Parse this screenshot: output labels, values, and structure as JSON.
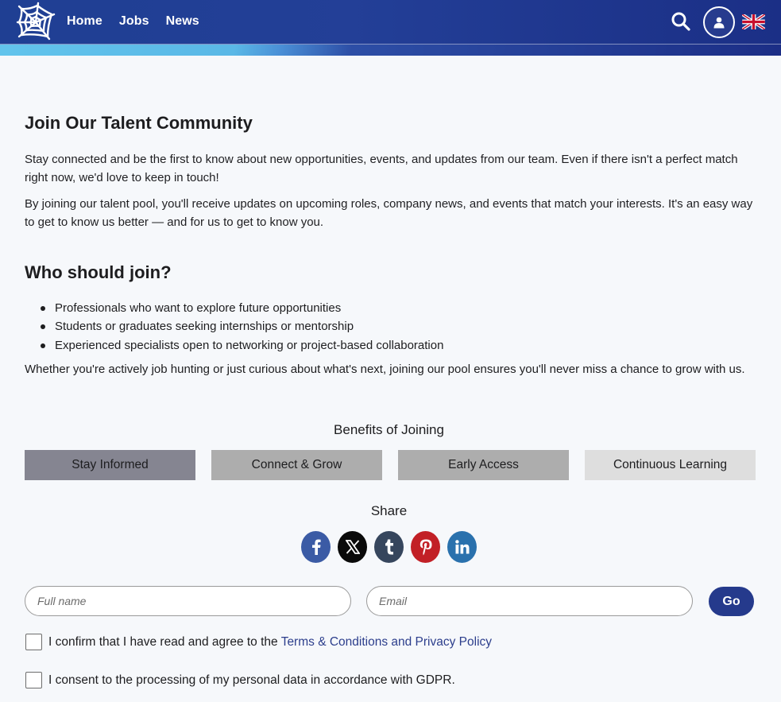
{
  "header": {
    "nav": [
      "Home",
      "Jobs",
      "News"
    ],
    "colors": {
      "bar": "#213f95",
      "stripe": "#5ab8e6",
      "accent": "#253a8c"
    },
    "icons": [
      "spiderweb-logo-icon",
      "search-icon",
      "user-icon",
      "uk-flag-icon"
    ]
  },
  "intro": {
    "title": "Join Our Talent Community",
    "p1": "Stay connected and be the first to know about new opportunities, events, and updates from our team. Even if there isn't a perfect match right now, we'd love to keep in touch!",
    "p2": "By joining our talent pool, you'll receive updates on upcoming roles, company news, and events that match your interests. It's an easy way to get to know us better — and for us to get to know you."
  },
  "who": {
    "title": "Who should join?",
    "items": [
      "Professionals who want to explore future opportunities",
      "Students or graduates seeking internships or mentorship",
      "Experienced specialists open to networking or project-based collaboration"
    ],
    "closing": "Whether you're actively job hunting or just curious about what's next, joining our pool ensures you'll never miss a chance to grow with us."
  },
  "benefits": {
    "title": "Benefits of Joining",
    "tabs": [
      "Stay Informed",
      "Connect & Grow",
      "Early Access",
      "Continuous Learning"
    ]
  },
  "share": {
    "title": "Share",
    "networks": [
      "facebook-icon",
      "x-icon",
      "tumblr-icon",
      "pinterest-icon",
      "linkedin-icon"
    ]
  },
  "form": {
    "fullname_placeholder": "Full name",
    "email_placeholder": "Email",
    "go_label": "Go",
    "consent1_prefix": "I confirm that I have read and agree to the ",
    "consent1_link": "Terms & Conditions and Privacy Policy",
    "consent2": "I consent to the processing of my personal data in accordance with GDPR."
  }
}
